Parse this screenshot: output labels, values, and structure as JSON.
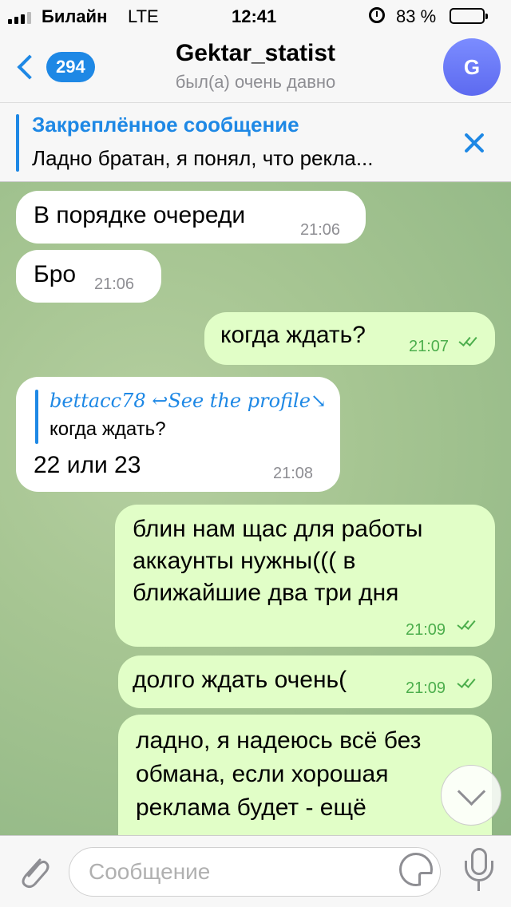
{
  "status": {
    "carrier": "Билайн",
    "network": "LTE",
    "time": "12:41",
    "battery": "83 %"
  },
  "header": {
    "back_count": "294",
    "title": "Gektar_statist",
    "subtitle": "был(а) очень давно",
    "avatar_letter": "G"
  },
  "pinned": {
    "title": "Закреплённое сообщение",
    "text": "Ладно братан, я понял, что рекла..."
  },
  "messages": [
    {
      "direction": "in",
      "text": "В порядке очереди",
      "time": "21:06"
    },
    {
      "direction": "in",
      "text": "Бро",
      "time": "21:06"
    },
    {
      "direction": "out",
      "text": "когда ждать?",
      "time": "21:07"
    },
    {
      "direction": "in",
      "reply_name": "bettacc78 ↩See the profile↘",
      "reply_text": "когда ждать?",
      "text": "22 или 23",
      "time": "21:08"
    },
    {
      "direction": "out",
      "lines": [
        "блин нам щас для работы",
        "аккаунты нужны((( в",
        "ближайшие два три дня"
      ],
      "time": "21:09"
    },
    {
      "direction": "out",
      "text": "долго ждать очень(",
      "time": "21:09"
    },
    {
      "direction": "out",
      "lines": [
        "ладно, я надеюсь всё без",
        "обмана, если хорошая",
        "реклама будет - ещё"
      ]
    }
  ],
  "input": {
    "placeholder": "Сообщение"
  },
  "colors": {
    "accent": "#1e88e5",
    "outgoing_bubble": "#e1fec7",
    "incoming_bubble": "#ffffff",
    "check_green": "#4cae4c"
  }
}
